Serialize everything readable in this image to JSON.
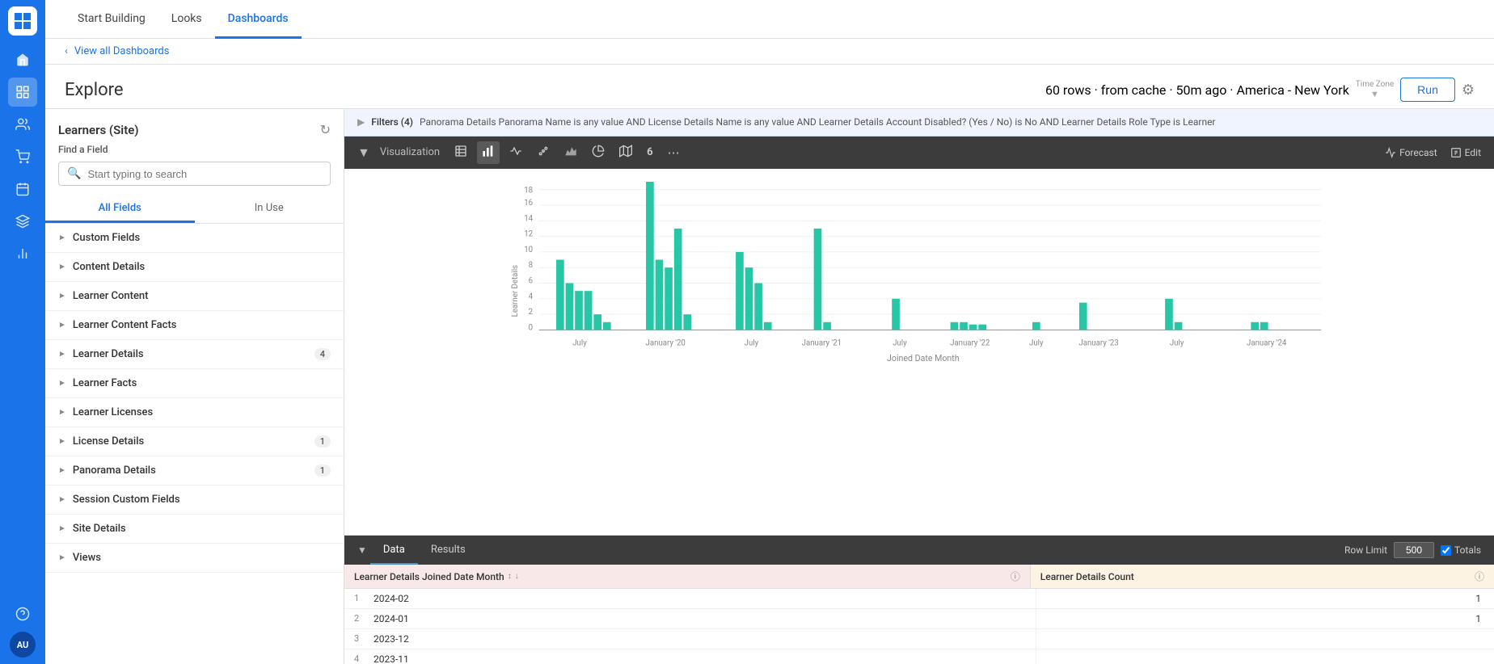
{
  "app": {
    "logo": "T",
    "avatar": "AU"
  },
  "topNav": {
    "items": [
      {
        "id": "start-building",
        "label": "Start Building",
        "active": false
      },
      {
        "id": "looks",
        "label": "Looks",
        "active": false
      },
      {
        "id": "dashboards",
        "label": "Dashboards",
        "active": true
      }
    ]
  },
  "breadcrumb": {
    "link": "View all Dashboards"
  },
  "pageTitle": "Explore",
  "metaInfo": "60 rows · from cache · 50m ago · America - New York",
  "timezoneLabel": "Time Zone",
  "runButton": "Run",
  "sidebar": {
    "title": "Learners (Site)",
    "findFieldLabel": "Find a Field",
    "searchPlaceholder": "Start typing to search",
    "tabs": [
      {
        "id": "all-fields",
        "label": "All Fields",
        "active": true
      },
      {
        "id": "in-use",
        "label": "In Use",
        "active": false
      }
    ],
    "fieldGroups": [
      {
        "id": "custom-fields",
        "label": "Custom Fields",
        "badge": null
      },
      {
        "id": "content-details",
        "label": "Content Details",
        "badge": null
      },
      {
        "id": "learner-content",
        "label": "Learner Content",
        "badge": null
      },
      {
        "id": "learner-content-facts",
        "label": "Learner Content Facts",
        "badge": null
      },
      {
        "id": "learner-details",
        "label": "Learner Details",
        "badge": "4"
      },
      {
        "id": "learner-facts",
        "label": "Learner Facts",
        "badge": null
      },
      {
        "id": "learner-licenses",
        "label": "Learner Licenses",
        "badge": null
      },
      {
        "id": "license-details",
        "label": "License Details",
        "badge": "1"
      },
      {
        "id": "panorama-details",
        "label": "Panorama Details",
        "badge": "1"
      },
      {
        "id": "session-custom-fields",
        "label": "Session Custom Fields",
        "badge": null
      },
      {
        "id": "site-details",
        "label": "Site Details",
        "badge": null
      },
      {
        "id": "views",
        "label": "Views",
        "badge": null
      }
    ]
  },
  "filterBar": {
    "label": "Filters (4)",
    "text": "Panorama Details Panorama Name is any value AND License Details Name is any value AND Learner Details Account Disabled? (Yes / No) is No AND Learner Details Role Type is Learner"
  },
  "visualization": {
    "label": "Visualization",
    "forecastLabel": "Forecast",
    "editLabel": "Edit"
  },
  "chart": {
    "yLabel": "Learner Details",
    "xLabel": "Joined Date Month",
    "yMax": 18,
    "bars": [
      {
        "label": "July",
        "group": 1,
        "values": [
          9,
          6,
          5,
          5,
          2,
          1
        ]
      },
      {
        "label": "Jan '20",
        "group": 2,
        "values": [
          19,
          9,
          8,
          13,
          2,
          0
        ]
      },
      {
        "label": "July",
        "group": 3,
        "values": [
          10,
          8,
          6,
          0,
          1,
          0
        ]
      },
      {
        "label": "Jan '21",
        "group": 4,
        "values": [
          13,
          0,
          0,
          0,
          1,
          0
        ]
      },
      {
        "label": "July",
        "group": 5,
        "values": [
          4,
          0,
          0,
          0,
          0,
          0
        ]
      },
      {
        "label": "Jan '22",
        "group": 6,
        "values": [
          1,
          1,
          0,
          0,
          0,
          0
        ]
      },
      {
        "label": "July",
        "group": 7,
        "values": [
          1,
          0,
          0,
          0,
          0,
          0
        ]
      },
      {
        "label": "Jan '23",
        "group": 8,
        "values": [
          5,
          0,
          0,
          0,
          0,
          0
        ]
      },
      {
        "label": "July",
        "group": 9,
        "values": [
          4,
          1,
          0,
          0,
          0,
          0
        ]
      },
      {
        "label": "Jan '24",
        "group": 10,
        "values": [
          1,
          1,
          0,
          0,
          0,
          0
        ]
      }
    ]
  },
  "dataSection": {
    "tabs": [
      {
        "id": "data",
        "label": "Data",
        "active": true
      },
      {
        "id": "results",
        "label": "Results",
        "active": false
      }
    ],
    "rowLimitLabel": "Row Limit",
    "rowLimitValue": "500",
    "totalsLabel": "Totals",
    "columns": [
      {
        "id": "date-col",
        "label": "Learner Details Joined Date Month"
      },
      {
        "id": "count-col",
        "label": "Learner Details Count"
      }
    ],
    "rows": [
      {
        "num": "1",
        "date": "2024-02",
        "count": "1"
      },
      {
        "num": "2",
        "date": "2024-01",
        "count": "1"
      },
      {
        "num": "3",
        "date": "2023-12",
        "count": ""
      },
      {
        "num": "4",
        "date": "2023-11",
        "count": ""
      }
    ]
  }
}
